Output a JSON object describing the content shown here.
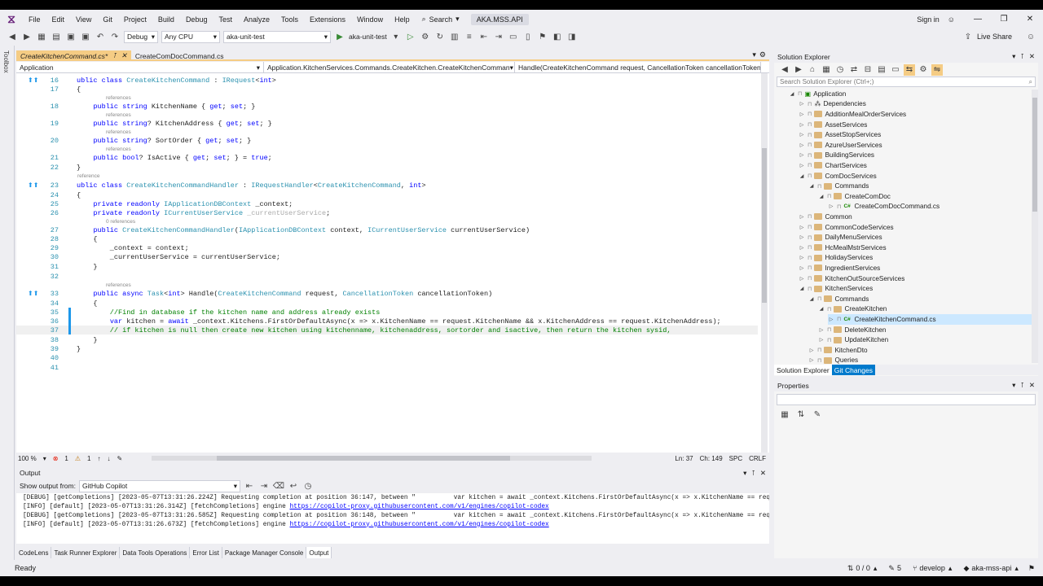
{
  "menubar": {
    "items": [
      "File",
      "Edit",
      "View",
      "Git",
      "Project",
      "Build",
      "Debug",
      "Test",
      "Analyze",
      "Tools",
      "Extensions",
      "Window",
      "Help"
    ],
    "search_label": "Search",
    "solution_title": "AKA.MSS.API",
    "sign_in": "Sign in",
    "live_share": "Live Share"
  },
  "toolbar": {
    "config": "Debug",
    "platform": "Any CPU",
    "startup_project": "aka-unit-test",
    "run_label": "aka-unit-test"
  },
  "toolbox": {
    "label": "Toolbox"
  },
  "tabs": {
    "active": "CreateKitchenCommand.cs*",
    "other": "CreateComDocCommand.cs"
  },
  "navbar": {
    "project": "Application",
    "type": "Application.KitchenServices.Commands.CreateKitchen.CreateKitchenComman",
    "member": "Handle(CreateKitchenCommand request, CancellationToken cancellationToken"
  },
  "code": {
    "lines": [
      {
        "n": "16",
        "text": "ublic class CreateKitchenCommand : IRequest<int>"
      },
      {
        "n": "17",
        "text": "{"
      },
      {
        "n": "18",
        "text": "    public string KitchenName { get; set; }"
      },
      {
        "n": "19",
        "text": "    public string? KitchenAddress { get; set; }"
      },
      {
        "n": "20",
        "text": "    public string? SortOrder { get; set; }"
      },
      {
        "n": "21",
        "text": "    public bool? IsActive { get; set; } = true;"
      },
      {
        "n": "22",
        "text": "}"
      },
      {
        "n": "23",
        "text": "ublic class CreateKitchenCommandHandler : IRequestHandler<CreateKitchenCommand, int>"
      },
      {
        "n": "24",
        "text": "{"
      },
      {
        "n": "25",
        "text": "    private readonly IApplicationDBContext _context;"
      },
      {
        "n": "26",
        "text": "    private readonly ICurrentUserService _currentUserService;"
      },
      {
        "n": "27",
        "text": "    public CreateKitchenCommandHandler(IApplicationDBContext context, ICurrentUserService currentUserService)"
      },
      {
        "n": "28",
        "text": "    {"
      },
      {
        "n": "29",
        "text": "        _context = context;"
      },
      {
        "n": "30",
        "text": "        _currentUserService = currentUserService;"
      },
      {
        "n": "31",
        "text": "    }"
      },
      {
        "n": "32",
        "text": ""
      },
      {
        "n": "33",
        "text": "    public async Task<int> Handle(CreateKitchenCommand request, CancellationToken cancellationToken)"
      },
      {
        "n": "34",
        "text": "    {"
      },
      {
        "n": "35",
        "text": "        //Find in database if the kitchen name and address already exists"
      },
      {
        "n": "36",
        "text": "        var kitchen = await _context.Kitchens.FirstOrDefaultAsync(x => x.KitchenName == request.KitchenName && x.KitchenAddress == request.KitchenAddress);"
      },
      {
        "n": "37",
        "text": "        // if kitchen is null then create new kitchen using kitchenname, kitchenaddress, sortorder and isactive, then return the kitchen sysid, "
      },
      {
        "n": "38",
        "text": "    }"
      },
      {
        "n": "39",
        "text": "}"
      },
      {
        "n": "40",
        "text": ""
      },
      {
        "n": "41",
        "text": ""
      }
    ],
    "ref_label": "references",
    "ref_zero": "0 references",
    "ref_single": "reference"
  },
  "editor_status": {
    "zoom": "100 %",
    "errors": "1",
    "warnings": "1",
    "position": "Ln: 37",
    "char": "Ch: 149",
    "spc": "SPC",
    "crlf": "CRLF"
  },
  "output": {
    "title": "Output",
    "show_from_label": "Show output from:",
    "source": "GitHub Copilot",
    "lines": [
      {
        "text": "[DEBUG] [getCompletions] [2023-05-07T13:31:26.224Z] Requesting completion at position 36:147, between \"          var kitchen = await _context.Kitchens.FirstOrDefaultAsync(x => x.KitchenName == request.",
        "link": ""
      },
      {
        "text": "[INFO] [default] [2023-05-07T13:31:26.314Z] [fetchCompletions] engine ",
        "link": "https://copilot-proxy.githubusercontent.com/v1/engines/copilot-codex"
      },
      {
        "text": "[DEBUG] [getCompletions] [2023-05-07T13:31:26.585Z] Requesting completion at position 36:148, between \"          var kitchen = await _context.Kitchens.FirstOrDefaultAsync(x => x.KitchenName == request.",
        "link": ""
      },
      {
        "text": "[INFO] [default] [2023-05-07T13:31:26.673Z] [fetchCompletions] engine ",
        "link": "https://copilot-proxy.githubusercontent.com/v1/engines/copilot-codex"
      }
    ]
  },
  "bottom_tabs": [
    "CodeLens",
    "Task Runner Explorer",
    "Data Tools Operations",
    "Error List",
    "Package Manager Console",
    "Output"
  ],
  "statusbar": {
    "ready": "Ready",
    "changes": "0 / 0",
    "edits": "5",
    "branch": "develop",
    "repo": "aka-mss-api"
  },
  "solution_explorer": {
    "title": "Solution Explorer",
    "search_placeholder": "Search Solution Explorer (Ctrl+;)",
    "items": [
      {
        "label": "Application",
        "depth": 0,
        "kind": "project",
        "open": true
      },
      {
        "label": "Dependencies",
        "depth": 1,
        "kind": "deps",
        "open": false
      },
      {
        "label": "AdditionMealOrderServices",
        "depth": 1,
        "kind": "folder",
        "open": false
      },
      {
        "label": "AssetServices",
        "depth": 1,
        "kind": "folder",
        "open": false
      },
      {
        "label": "AssetStopServices",
        "depth": 1,
        "kind": "folder",
        "open": false
      },
      {
        "label": "AzureUserServices",
        "depth": 1,
        "kind": "folder",
        "open": false
      },
      {
        "label": "BuildingServices",
        "depth": 1,
        "kind": "folder",
        "open": false
      },
      {
        "label": "ChartServices",
        "depth": 1,
        "kind": "folder",
        "open": false
      },
      {
        "label": "ComDocServices",
        "depth": 1,
        "kind": "folder",
        "open": true
      },
      {
        "label": "Commands",
        "depth": 2,
        "kind": "folder",
        "open": true
      },
      {
        "label": "CreateComDoc",
        "depth": 3,
        "kind": "folder",
        "open": true
      },
      {
        "label": "CreateComDocCommand.cs",
        "depth": 4,
        "kind": "file",
        "open": false
      },
      {
        "label": "Common",
        "depth": 1,
        "kind": "folder",
        "open": false
      },
      {
        "label": "CommonCodeServices",
        "depth": 1,
        "kind": "folder",
        "open": false
      },
      {
        "label": "DailyMenuServices",
        "depth": 1,
        "kind": "folder",
        "open": false
      },
      {
        "label": "HcMealMstrServices",
        "depth": 1,
        "kind": "folder",
        "open": false
      },
      {
        "label": "HolidayServices",
        "depth": 1,
        "kind": "folder",
        "open": false
      },
      {
        "label": "IngredientServices",
        "depth": 1,
        "kind": "folder",
        "open": false
      },
      {
        "label": "KitchenOutSourceServices",
        "depth": 1,
        "kind": "folder",
        "open": false
      },
      {
        "label": "KitchenServices",
        "depth": 1,
        "kind": "folder",
        "open": true
      },
      {
        "label": "Commands",
        "depth": 2,
        "kind": "folder",
        "open": true
      },
      {
        "label": "CreateKitchen",
        "depth": 3,
        "kind": "folder",
        "open": true
      },
      {
        "label": "CreateKitchenCommand.cs",
        "depth": 4,
        "kind": "file",
        "open": false,
        "selected": true
      },
      {
        "label": "DeleteKitchen",
        "depth": 3,
        "kind": "folder",
        "open": false
      },
      {
        "label": "UpdateKitchen",
        "depth": 3,
        "kind": "folder",
        "open": false
      },
      {
        "label": "KitchenDto",
        "depth": 2,
        "kind": "folder",
        "open": false
      },
      {
        "label": "Queries",
        "depth": 2,
        "kind": "folder",
        "open": false
      }
    ],
    "tab_active": "Solution Explorer",
    "tab_other": "Git Changes"
  },
  "properties": {
    "title": "Properties"
  },
  "colors": {
    "accent": "#007acc",
    "tab_active": "#f5cc84",
    "keyword": "#0000ff",
    "type": "#2b91af",
    "comment": "#008000"
  }
}
